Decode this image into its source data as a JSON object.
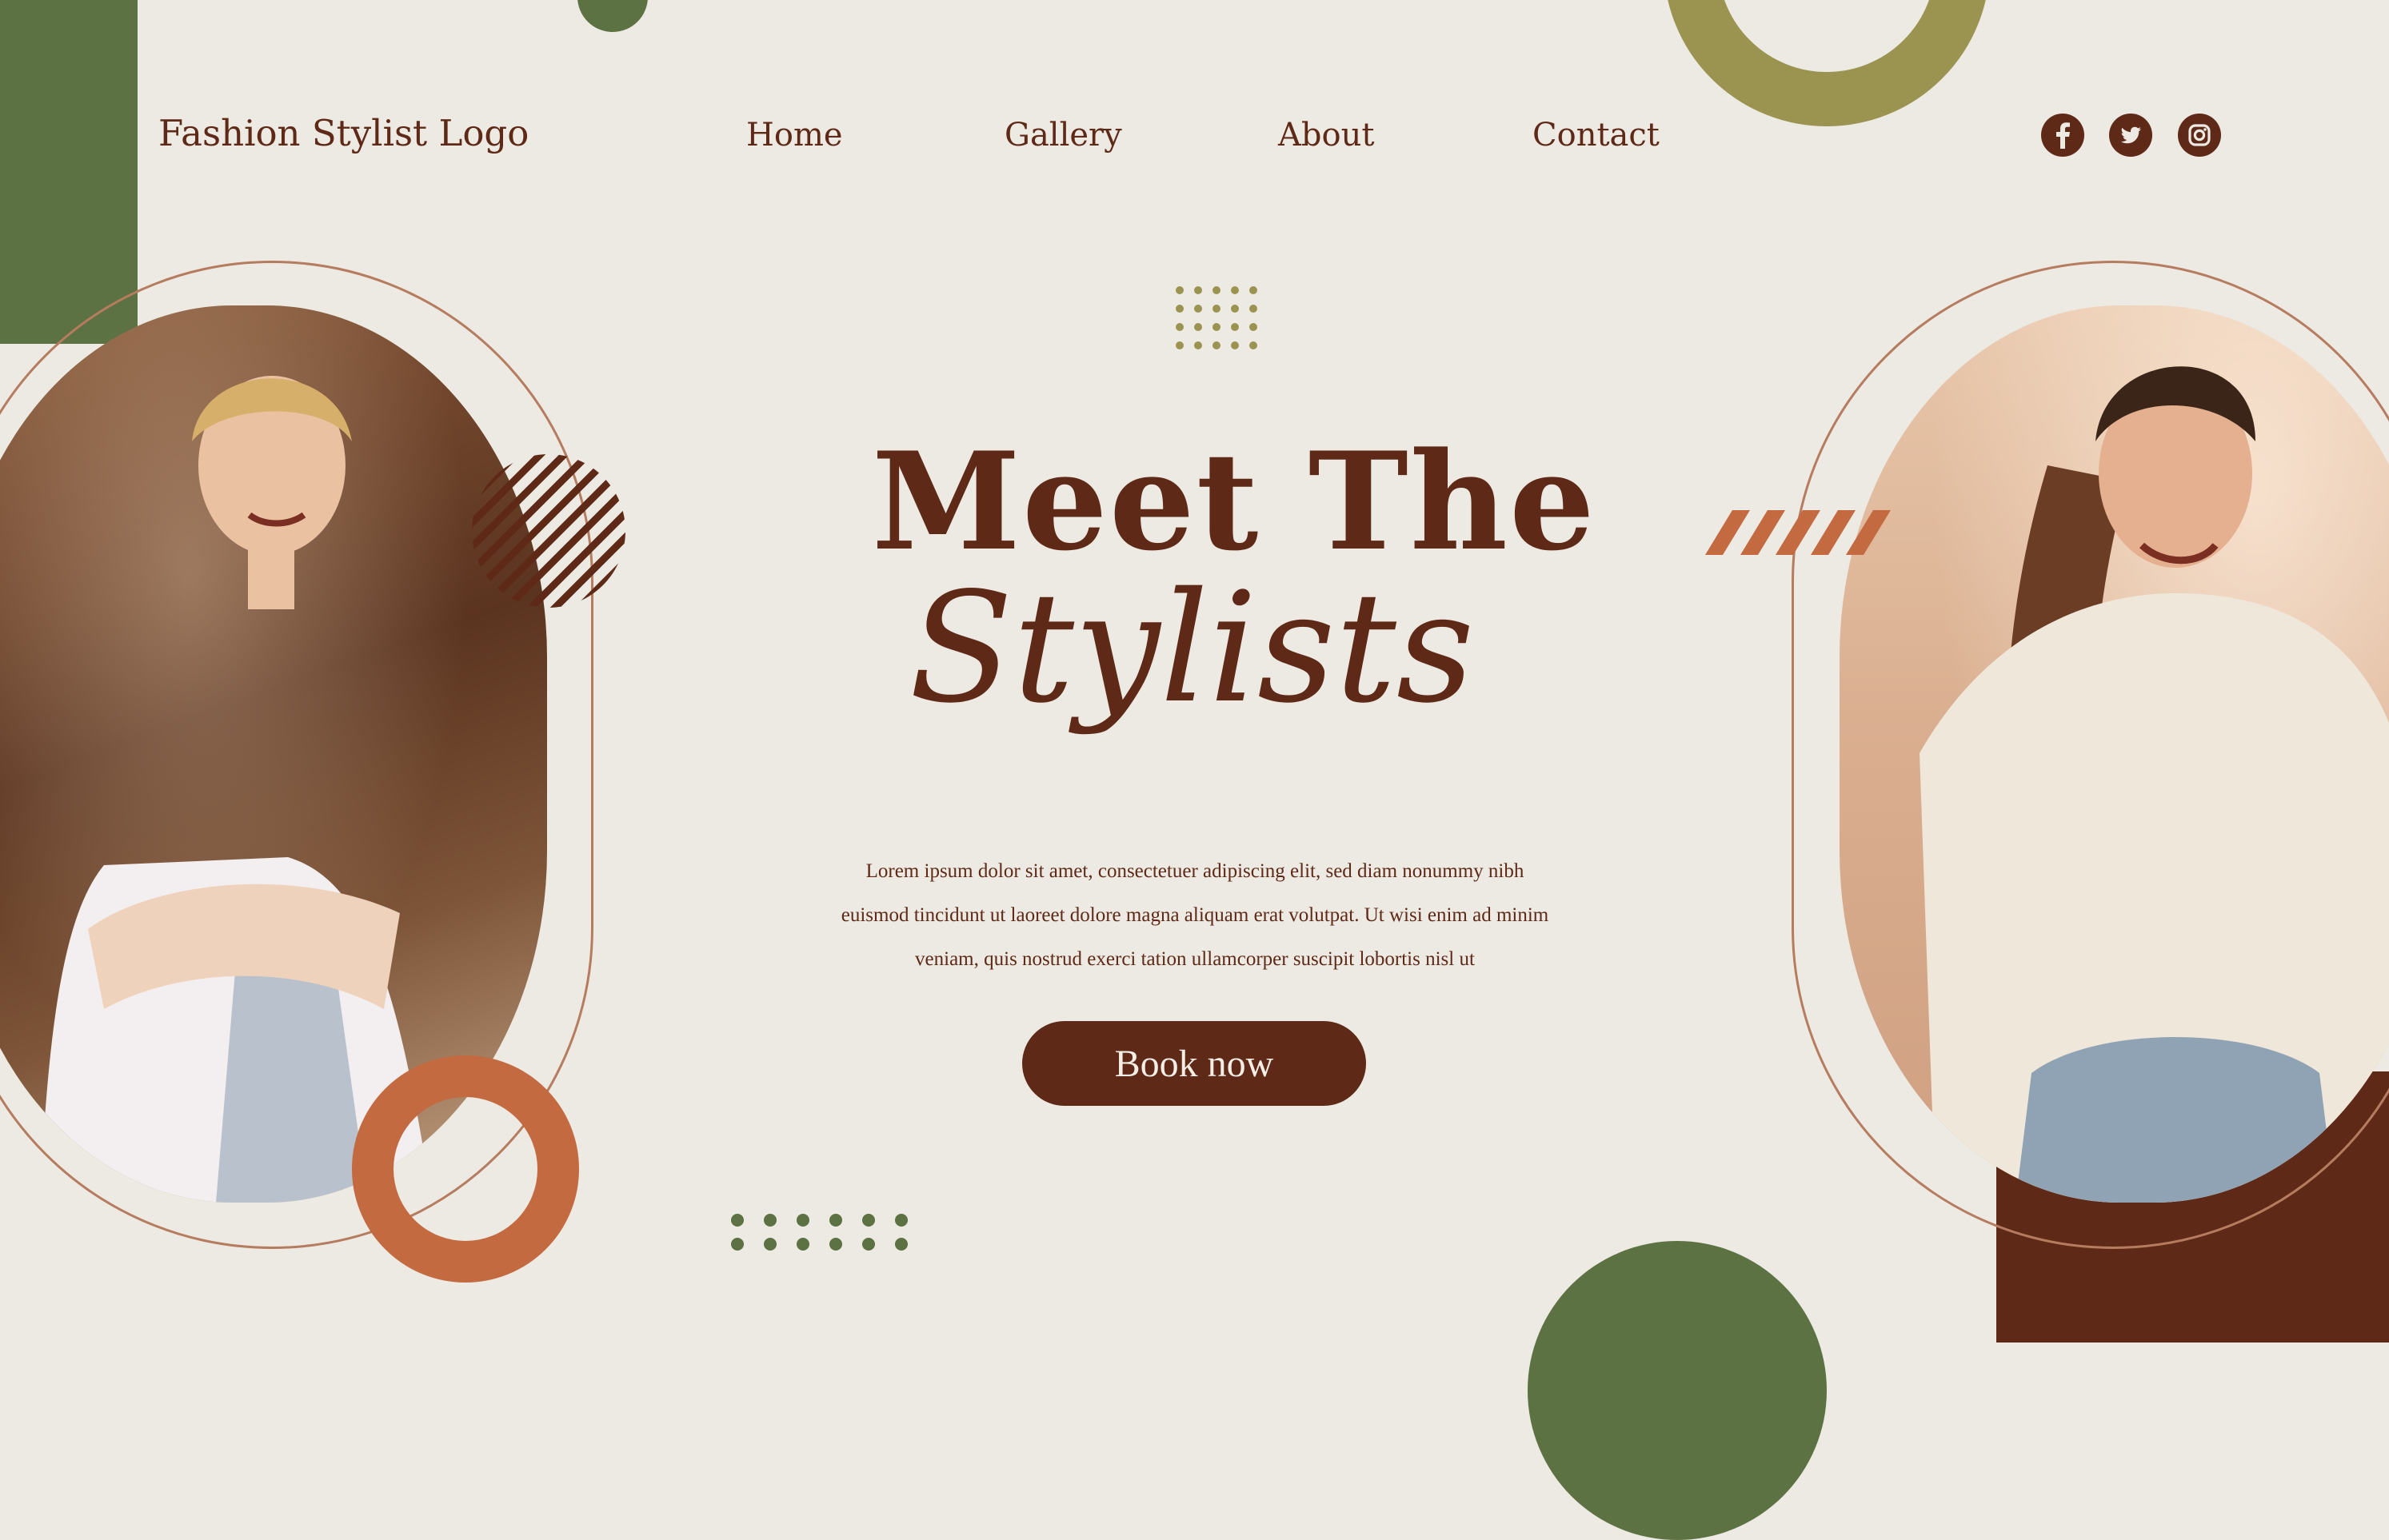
{
  "header": {
    "logo_text": "Fashion Stylist Logo",
    "nav": [
      "Home",
      "Gallery",
      "About",
      "Contact"
    ],
    "social": [
      "facebook-icon",
      "twitter-icon",
      "instagram-icon"
    ]
  },
  "hero": {
    "title_line1": "Meet The",
    "title_line2": "Stylists",
    "body": "Lorem ipsum dolor sit amet, consectetuer adipiscing elit, sed diam nonummy nibh euismod tincidunt ut laoreet dolore magna aliquam erat volutpat. Ut wisi enim ad minim veniam, quis nostrud exerci tation ullamcorper suscipit lobortis nisl ut",
    "cta_label": "Book now"
  },
  "colors": {
    "background": "#ede9e3",
    "primary_brown": "#5e2a17",
    "olive": "#9a9450",
    "green": "#5c7242",
    "orange": "#c46a40",
    "outline": "#b57c5f"
  }
}
